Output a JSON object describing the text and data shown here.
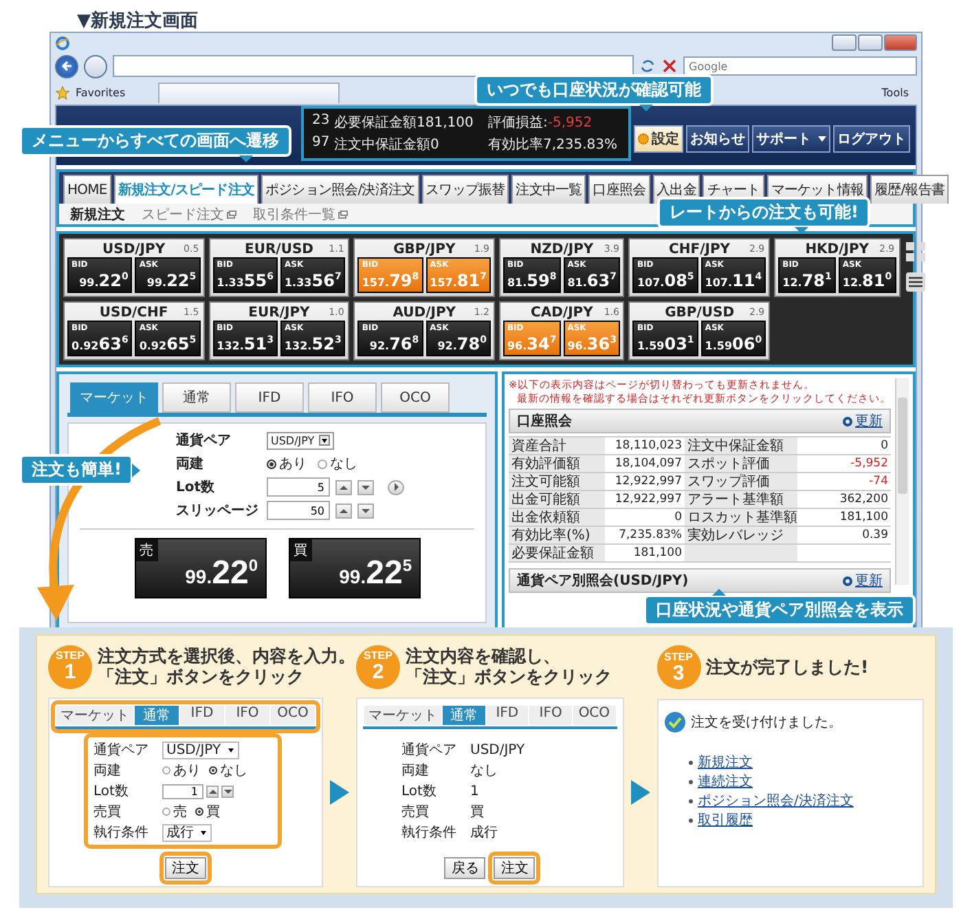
{
  "page_title": "▼新規注文画面",
  "browser": {
    "search_placeholder": "Google",
    "favorites": "Favorites",
    "tools": "Tools"
  },
  "account_info": [
    {
      "text": "23"
    },
    {
      "text": "必要保証金額181,100"
    },
    {
      "text": "評価損益:",
      "value": "-5,952"
    },
    {
      "text": "97"
    },
    {
      "text": "注文中保証金額0"
    },
    {
      "text": "有効比率7,235.83%"
    }
  ],
  "header_buttons": [
    {
      "label": "設定",
      "kind": "settings"
    },
    {
      "label": "お知らせ",
      "kind": "plain"
    },
    {
      "label": "サポート",
      "kind": "dropdown"
    },
    {
      "label": "ログアウト",
      "kind": "plain"
    }
  ],
  "menu": [
    {
      "label": "HOME",
      "selected": false
    },
    {
      "label": "新規注文/スピード注文",
      "selected": true
    },
    {
      "label": "ポジション照会/決済注文",
      "selected": false
    },
    {
      "label": "スワップ振替",
      "selected": false
    },
    {
      "label": "注文中一覧",
      "selected": false
    },
    {
      "label": "口座照会",
      "selected": false
    },
    {
      "label": "入出金",
      "selected": false
    },
    {
      "label": "チャート",
      "selected": false
    },
    {
      "label": "マーケット情報",
      "selected": false
    },
    {
      "label": "履歴/報告書",
      "selected": false
    }
  ],
  "submenu": [
    {
      "label": "新規注文",
      "selected": true,
      "popup": false
    },
    {
      "label": "スピード注文",
      "selected": false,
      "popup": true
    },
    {
      "label": "取引条件一覧",
      "selected": false,
      "popup": true
    }
  ],
  "rates": [
    {
      "pair": "USD/JPY",
      "spread": "0.5",
      "bid_label": "BID",
      "bid_lead": "99.",
      "bid_main": "22$^{0}$",
      "ask_label": "ASK",
      "ask_lead": "99.",
      "ask_main": "22$^{5}$",
      "highlight": false
    },
    {
      "pair": "EUR/USD",
      "spread": "1.1",
      "bid_label": "BID",
      "bid_lead": "1.33",
      "bid_main": "55$^{6}$",
      "ask_label": "ASK",
      "ask_lead": "1.33",
      "ask_main": "56$^{7}$",
      "highlight": false
    },
    {
      "pair": "GBP/JPY",
      "spread": "1.9",
      "bid_label": "BID",
      "bid_lead": "157.",
      "bid_main": "79$^{8}$",
      "ask_label": "ASK",
      "ask_lead": "157.",
      "ask_main": "81$^{7}$",
      "highlight": true
    },
    {
      "pair": "NZD/JPY",
      "spread": "3.9",
      "bid_label": "BID",
      "bid_lead": "81.",
      "bid_main": "59$^{8}$",
      "ask_label": "ASK",
      "ask_lead": "81.",
      "ask_main": "63$^{7}$",
      "highlight": false
    },
    {
      "pair": "CHF/JPY",
      "spread": "2.9",
      "bid_label": "BID",
      "bid_lead": "107.",
      "bid_main": "08$^{5}$",
      "ask_label": "ASK",
      "ask_lead": "107.",
      "ask_main": "11$^{4}$",
      "highlight": false
    },
    {
      "pair": "HKD/JPY",
      "spread": "2.9",
      "bid_label": "BID",
      "bid_lead": "12.",
      "bid_main": "78$^{1}$",
      "ask_label": "ASK",
      "ask_lead": "12.",
      "ask_main": "81$^{0}$",
      "highlight": false
    },
    {
      "pair": "USD/CHF",
      "spread": "1.5",
      "bid_label": "BID",
      "bid_lead": "0.92",
      "bid_main": "63$^{6}$",
      "ask_label": "ASK",
      "ask_lead": "0.92",
      "ask_main": "65$^{5}$",
      "highlight": false
    },
    {
      "pair": "EUR/JPY",
      "spread": "1.0",
      "bid_label": "BID",
      "bid_lead": "132.",
      "bid_main": "51$^{3}$",
      "ask_label": "ASK",
      "ask_lead": "132.",
      "ask_main": "52$^{3}$",
      "highlight": false
    },
    {
      "pair": "AUD/JPY",
      "spread": "1.2",
      "bid_label": "BID",
      "bid_lead": "92.",
      "bid_main": "76$^{8}$",
      "ask_label": "ASK",
      "ask_lead": "92.",
      "ask_main": "78$^{0}$",
      "highlight": false
    },
    {
      "pair": "CAD/JPY",
      "spread": "1.6",
      "bid_label": "BID",
      "bid_lead": "96.",
      "bid_main": "34$^{7}$",
      "ask_label": "ASK",
      "ask_lead": "96.",
      "ask_main": "36$^{3}$",
      "highlight": true
    },
    {
      "pair": "GBP/USD",
      "spread": "2.9",
      "bid_label": "BID",
      "bid_lead": "1.59",
      "bid_main": "03$^{1}$",
      "ask_label": "ASK",
      "ask_lead": "1.59",
      "ask_main": "06$^{0}$",
      "highlight": false
    }
  ],
  "order": {
    "tabs": [
      {
        "label": "マーケット",
        "selected": true
      },
      {
        "label": "通常",
        "selected": false
      },
      {
        "label": "IFD",
        "selected": false
      },
      {
        "label": "IFO",
        "selected": false
      },
      {
        "label": "OCO",
        "selected": false
      }
    ],
    "fields": [
      {
        "kind": "select",
        "label": "通貨ペア",
        "value": "USD/JPY"
      },
      {
        "kind": "radio",
        "label": "両建",
        "options": [
          {
            "label": "あり",
            "selected": true
          },
          {
            "label": "なし",
            "selected": false
          }
        ]
      },
      {
        "kind": "spinner",
        "label": "Lot数",
        "value": "5",
        "play": true
      },
      {
        "kind": "spinner",
        "label": "スリッページ",
        "value": "50",
        "play": false
      }
    ],
    "prices": [
      {
        "label": "売",
        "lead": "99.",
        "main": "22$^{0}$"
      },
      {
        "label": "買",
        "lead": "99.",
        "main": "22$^{5}$"
      }
    ]
  },
  "account": {
    "notes": [
      "※以下の表示内容はページが切り替わっても更新されません。",
      "最新の情報を確認する場合はそれぞれ更新ボタンをクリックしてください。"
    ],
    "title": "口座照会",
    "refresh": "更新",
    "rows": [
      {
        "label_1": "資産合計",
        "value_1": "18,110,023",
        "label_2": "注文中保証金額",
        "value_2": "0",
        "alert": false
      },
      {
        "label_1": "有効評価額",
        "value_1": "18,104,097",
        "label_2": "スポット評価",
        "value_2": "-5,952",
        "alert": true
      },
      {
        "label_1": "注文可能額",
        "value_1": "12,922,997",
        "label_2": "スワップ評価",
        "value_2": "-74",
        "alert": true
      },
      {
        "label_1": "出金可能額",
        "value_1": "12,922,997",
        "label_2": "アラート基準額",
        "value_2": "362,200",
        "alert": false
      },
      {
        "label_1": "出金依頼額",
        "value_1": "0",
        "label_2": "ロスカット基準額",
        "value_2": "181,100",
        "alert": false
      },
      {
        "label_1": "有効比率(%)",
        "value_1": "7,235.83%",
        "label_2": "実効レバレッジ",
        "value_2": "0.39",
        "alert": false
      },
      {
        "label_1": "必要保証金額",
        "value_1": "181,100"
      }
    ],
    "pair_title": "通貨ペア別照会(USD/JPY)",
    "pair_refresh": "更新"
  },
  "callouts": [
    "いつでも口座状況が確認可能",
    "メニューからすべての画面へ遷移",
    "レートからの注文も可能!",
    "注文も簡単!",
    "口座状況や通貨ペア別照会を表示"
  ],
  "steps": [
    {
      "kind": "input",
      "badge": "STEP",
      "number": "1",
      "lines": [
        "注文方式を選択後、内容を入力。",
        "「注文」ボタンをクリック"
      ],
      "tabs": [
        {
          "label": "マーケット",
          "selected": false
        },
        {
          "label": "通常",
          "selected": true
        },
        {
          "label": "IFD",
          "selected": false
        },
        {
          "label": "IFO",
          "selected": false
        },
        {
          "label": "OCO",
          "selected": false
        }
      ],
      "fields": [
        {
          "kind": "select",
          "label": "通貨ペア",
          "value": "USD/JPY"
        },
        {
          "kind": "radio",
          "label": "両建",
          "options": [
            {
              "label": "あり",
              "selected": false
            },
            {
              "label": "なし",
              "selected": true
            }
          ]
        },
        {
          "kind": "spinner",
          "label": "Lot数",
          "value": "1"
        },
        {
          "kind": "radio",
          "label": "売買",
          "options": [
            {
              "label": "売",
              "selected": false
            },
            {
              "label": "買",
              "selected": true
            }
          ]
        },
        {
          "kind": "select",
          "label": "執行条件",
          "value": "成行"
        }
      ],
      "buttons": [
        {
          "label": "注文",
          "highlight": true
        }
      ]
    },
    {
      "kind": "confirm",
      "badge": "STEP",
      "number": "2",
      "lines": [
        "注文内容を確認し、",
        "「注文」ボタンをクリック"
      ],
      "tabs": [
        {
          "label": "マーケット",
          "selected": false
        },
        {
          "label": "通常",
          "selected": true
        },
        {
          "label": "IFD",
          "selected": false
        },
        {
          "label": "IFO",
          "selected": false
        },
        {
          "label": "OCO",
          "selected": false
        }
      ],
      "fields": [
        {
          "kind": "text",
          "label": "通貨ペア",
          "value": "USD/JPY"
        },
        {
          "kind": "text",
          "label": "両建",
          "value": "なし"
        },
        {
          "kind": "text",
          "label": "Lot数",
          "value": "1"
        },
        {
          "kind": "text",
          "label": "売買",
          "value": "買"
        },
        {
          "kind": "text",
          "label": "執行条件",
          "value": "成行"
        }
      ],
      "buttons": [
        {
          "label": "戻る",
          "highlight": false
        },
        {
          "label": "注文",
          "highlight": true
        }
      ]
    },
    {
      "kind": "done",
      "badge": "STEP",
      "number": "3",
      "lines": [
        "注文が完了しました!"
      ],
      "message": "注文を受け付けました。",
      "links": [
        "新規注文",
        "連続注文",
        "ポジション照会/決済注文",
        "取引履歴"
      ]
    }
  ]
}
